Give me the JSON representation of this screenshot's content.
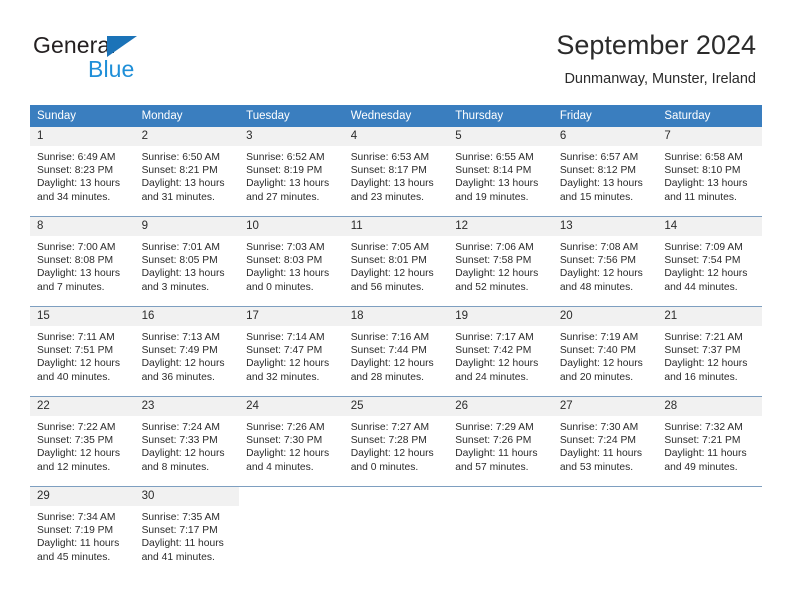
{
  "brand": {
    "name_part1": "General",
    "name_part2": "Blue",
    "triangle_icon": "blue-triangle-icon",
    "accent_color": "#1f8fd8",
    "triangle_color": "#1b73b8"
  },
  "header": {
    "title": "September 2024",
    "subtitle": "Dunmanway, Munster, Ireland"
  },
  "calendar": {
    "header_bg": "#3a7ebf",
    "daynum_bg": "#f1f1f1",
    "row_separator_color": "#7e9fc0",
    "weekdays": [
      "Sunday",
      "Monday",
      "Tuesday",
      "Wednesday",
      "Thursday",
      "Friday",
      "Saturday"
    ],
    "weeks": [
      [
        {
          "day": "1",
          "sunrise": "Sunrise: 6:49 AM",
          "sunset": "Sunset: 8:23 PM",
          "daylight_line1": "Daylight: 13 hours",
          "daylight_line2": "and 34 minutes."
        },
        {
          "day": "2",
          "sunrise": "Sunrise: 6:50 AM",
          "sunset": "Sunset: 8:21 PM",
          "daylight_line1": "Daylight: 13 hours",
          "daylight_line2": "and 31 minutes."
        },
        {
          "day": "3",
          "sunrise": "Sunrise: 6:52 AM",
          "sunset": "Sunset: 8:19 PM",
          "daylight_line1": "Daylight: 13 hours",
          "daylight_line2": "and 27 minutes."
        },
        {
          "day": "4",
          "sunrise": "Sunrise: 6:53 AM",
          "sunset": "Sunset: 8:17 PM",
          "daylight_line1": "Daylight: 13 hours",
          "daylight_line2": "and 23 minutes."
        },
        {
          "day": "5",
          "sunrise": "Sunrise: 6:55 AM",
          "sunset": "Sunset: 8:14 PM",
          "daylight_line1": "Daylight: 13 hours",
          "daylight_line2": "and 19 minutes."
        },
        {
          "day": "6",
          "sunrise": "Sunrise: 6:57 AM",
          "sunset": "Sunset: 8:12 PM",
          "daylight_line1": "Daylight: 13 hours",
          "daylight_line2": "and 15 minutes."
        },
        {
          "day": "7",
          "sunrise": "Sunrise: 6:58 AM",
          "sunset": "Sunset: 8:10 PM",
          "daylight_line1": "Daylight: 13 hours",
          "daylight_line2": "and 11 minutes."
        }
      ],
      [
        {
          "day": "8",
          "sunrise": "Sunrise: 7:00 AM",
          "sunset": "Sunset: 8:08 PM",
          "daylight_line1": "Daylight: 13 hours",
          "daylight_line2": "and 7 minutes."
        },
        {
          "day": "9",
          "sunrise": "Sunrise: 7:01 AM",
          "sunset": "Sunset: 8:05 PM",
          "daylight_line1": "Daylight: 13 hours",
          "daylight_line2": "and 3 minutes."
        },
        {
          "day": "10",
          "sunrise": "Sunrise: 7:03 AM",
          "sunset": "Sunset: 8:03 PM",
          "daylight_line1": "Daylight: 13 hours",
          "daylight_line2": "and 0 minutes."
        },
        {
          "day": "11",
          "sunrise": "Sunrise: 7:05 AM",
          "sunset": "Sunset: 8:01 PM",
          "daylight_line1": "Daylight: 12 hours",
          "daylight_line2": "and 56 minutes."
        },
        {
          "day": "12",
          "sunrise": "Sunrise: 7:06 AM",
          "sunset": "Sunset: 7:58 PM",
          "daylight_line1": "Daylight: 12 hours",
          "daylight_line2": "and 52 minutes."
        },
        {
          "day": "13",
          "sunrise": "Sunrise: 7:08 AM",
          "sunset": "Sunset: 7:56 PM",
          "daylight_line1": "Daylight: 12 hours",
          "daylight_line2": "and 48 minutes."
        },
        {
          "day": "14",
          "sunrise": "Sunrise: 7:09 AM",
          "sunset": "Sunset: 7:54 PM",
          "daylight_line1": "Daylight: 12 hours",
          "daylight_line2": "and 44 minutes."
        }
      ],
      [
        {
          "day": "15",
          "sunrise": "Sunrise: 7:11 AM",
          "sunset": "Sunset: 7:51 PM",
          "daylight_line1": "Daylight: 12 hours",
          "daylight_line2": "and 40 minutes."
        },
        {
          "day": "16",
          "sunrise": "Sunrise: 7:13 AM",
          "sunset": "Sunset: 7:49 PM",
          "daylight_line1": "Daylight: 12 hours",
          "daylight_line2": "and 36 minutes."
        },
        {
          "day": "17",
          "sunrise": "Sunrise: 7:14 AM",
          "sunset": "Sunset: 7:47 PM",
          "daylight_line1": "Daylight: 12 hours",
          "daylight_line2": "and 32 minutes."
        },
        {
          "day": "18",
          "sunrise": "Sunrise: 7:16 AM",
          "sunset": "Sunset: 7:44 PM",
          "daylight_line1": "Daylight: 12 hours",
          "daylight_line2": "and 28 minutes."
        },
        {
          "day": "19",
          "sunrise": "Sunrise: 7:17 AM",
          "sunset": "Sunset: 7:42 PM",
          "daylight_line1": "Daylight: 12 hours",
          "daylight_line2": "and 24 minutes."
        },
        {
          "day": "20",
          "sunrise": "Sunrise: 7:19 AM",
          "sunset": "Sunset: 7:40 PM",
          "daylight_line1": "Daylight: 12 hours",
          "daylight_line2": "and 20 minutes."
        },
        {
          "day": "21",
          "sunrise": "Sunrise: 7:21 AM",
          "sunset": "Sunset: 7:37 PM",
          "daylight_line1": "Daylight: 12 hours",
          "daylight_line2": "and 16 minutes."
        }
      ],
      [
        {
          "day": "22",
          "sunrise": "Sunrise: 7:22 AM",
          "sunset": "Sunset: 7:35 PM",
          "daylight_line1": "Daylight: 12 hours",
          "daylight_line2": "and 12 minutes."
        },
        {
          "day": "23",
          "sunrise": "Sunrise: 7:24 AM",
          "sunset": "Sunset: 7:33 PM",
          "daylight_line1": "Daylight: 12 hours",
          "daylight_line2": "and 8 minutes."
        },
        {
          "day": "24",
          "sunrise": "Sunrise: 7:26 AM",
          "sunset": "Sunset: 7:30 PM",
          "daylight_line1": "Daylight: 12 hours",
          "daylight_line2": "and 4 minutes."
        },
        {
          "day": "25",
          "sunrise": "Sunrise: 7:27 AM",
          "sunset": "Sunset: 7:28 PM",
          "daylight_line1": "Daylight: 12 hours",
          "daylight_line2": "and 0 minutes."
        },
        {
          "day": "26",
          "sunrise": "Sunrise: 7:29 AM",
          "sunset": "Sunset: 7:26 PM",
          "daylight_line1": "Daylight: 11 hours",
          "daylight_line2": "and 57 minutes."
        },
        {
          "day": "27",
          "sunrise": "Sunrise: 7:30 AM",
          "sunset": "Sunset: 7:24 PM",
          "daylight_line1": "Daylight: 11 hours",
          "daylight_line2": "and 53 minutes."
        },
        {
          "day": "28",
          "sunrise": "Sunrise: 7:32 AM",
          "sunset": "Sunset: 7:21 PM",
          "daylight_line1": "Daylight: 11 hours",
          "daylight_line2": "and 49 minutes."
        }
      ],
      [
        {
          "day": "29",
          "sunrise": "Sunrise: 7:34 AM",
          "sunset": "Sunset: 7:19 PM",
          "daylight_line1": "Daylight: 11 hours",
          "daylight_line2": "and 45 minutes."
        },
        {
          "day": "30",
          "sunrise": "Sunrise: 7:35 AM",
          "sunset": "Sunset: 7:17 PM",
          "daylight_line1": "Daylight: 11 hours",
          "daylight_line2": "and 41 minutes."
        },
        {
          "day": "",
          "sunrise": "",
          "sunset": "",
          "daylight_line1": "",
          "daylight_line2": ""
        },
        {
          "day": "",
          "sunrise": "",
          "sunset": "",
          "daylight_line1": "",
          "daylight_line2": ""
        },
        {
          "day": "",
          "sunrise": "",
          "sunset": "",
          "daylight_line1": "",
          "daylight_line2": ""
        },
        {
          "day": "",
          "sunrise": "",
          "sunset": "",
          "daylight_line1": "",
          "daylight_line2": ""
        },
        {
          "day": "",
          "sunrise": "",
          "sunset": "",
          "daylight_line1": "",
          "daylight_line2": ""
        }
      ]
    ]
  }
}
